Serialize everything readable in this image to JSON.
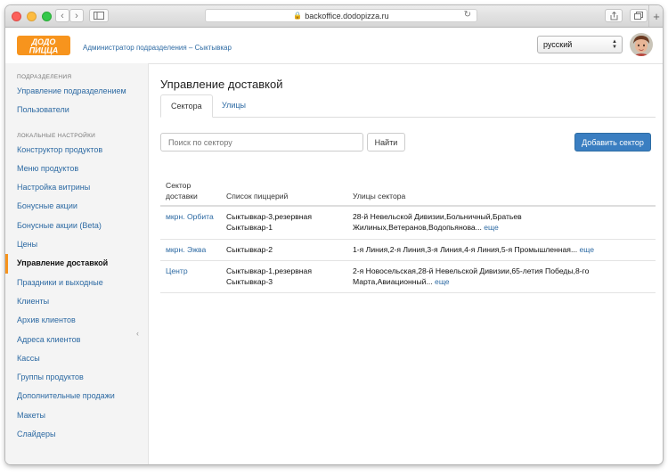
{
  "browser": {
    "url": "backoffice.dodopizza.ru"
  },
  "header": {
    "logo_alt": "ДОДО ПИЦЦА",
    "title": "Администратор подразделения – Сыктывкар",
    "language": "русский"
  },
  "sidebar": {
    "section1_title": "ПОДРАЗДЕЛЕНИЯ",
    "section1_items": [
      "Управление подразделением",
      "Пользователи"
    ],
    "section2_title": "ЛОКАЛЬНЫЕ НАСТРОЙКИ",
    "section2_items": [
      "Конструктор продуктов",
      "Меню продуктов",
      "Настройка витрины",
      "Бонусные акции",
      "Бонусные акции (Beta)",
      "Цены",
      "Управление доставкой",
      "Праздники и выходные",
      "Клиенты",
      "Архив клиентов",
      "Адреса клиентов",
      "Кассы",
      "Группы продуктов",
      "Дополнительные продажи",
      "Макеты",
      "Слайдеры"
    ],
    "active_item": "Управление доставкой"
  },
  "main": {
    "title": "Управление доставкой",
    "tabs": [
      "Сектора",
      "Улицы"
    ],
    "search_placeholder": "Поиск по сектору",
    "find_label": "Найти",
    "add_label": "Добавить сектор",
    "table": {
      "col_sector_line1": "Сектор",
      "col_sector_line2": "доставки",
      "col_pizzerias": "Список пиццерий",
      "col_streets": "Улицы сектора",
      "more_label": "еще",
      "rows": [
        {
          "sector": "мкрн. Орбита",
          "pizzerias": [
            "Сыктывкар-3,резервная",
            "Сыктывкар-1"
          ],
          "streets": "28-й Невельской Дивизии,Больничный,Братьев Жилиных,Ветеранов,Водопьянова..."
        },
        {
          "sector": "мкрн. Эжва",
          "pizzerias": [
            "Сыктывкар-2"
          ],
          "streets": "1-я Линия,2-я Линия,3-я Линия,4-я Линия,5-я Промышленная..."
        },
        {
          "sector": "Центр",
          "pizzerias": [
            "Сыктывкар-1,резервная",
            "Сыктывкар-3"
          ],
          "streets": "2-я Новосельская,28-й Невельской Дивизии,65-летия Победы,8-го Марта,Авиационный..."
        }
      ]
    }
  },
  "colors": {
    "link": "#2d6aa3",
    "primary_button": "#3a7ec1",
    "active_marker": "#f7941d"
  }
}
